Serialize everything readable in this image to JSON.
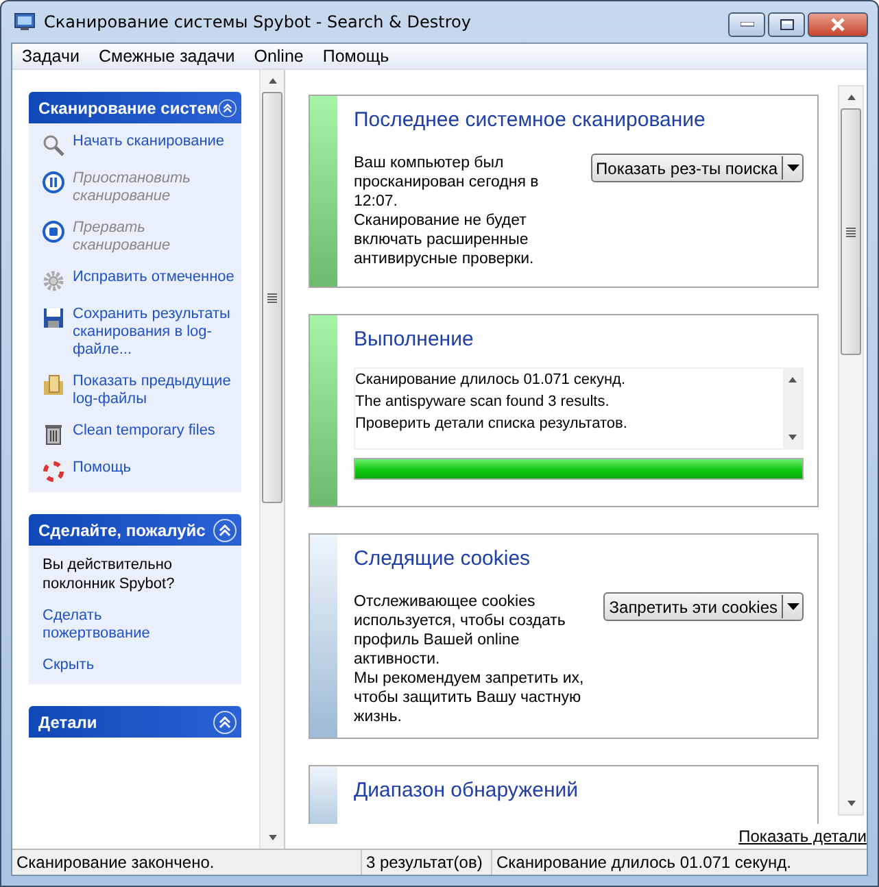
{
  "window": {
    "title": "Сканирование системы  Spybot - Search & Destroy"
  },
  "menu": [
    "Задачи",
    "Смежные задачи",
    "Online",
    "Помощь"
  ],
  "task_panels": [
    {
      "title": "Сканирование систем",
      "expanded": true,
      "items": [
        {
          "kind": "link",
          "label": "Начать сканирование",
          "disabled": false
        },
        {
          "kind": "link",
          "label": "Приостановить сканирование",
          "disabled": true
        },
        {
          "kind": "link",
          "label": "Прервать сканирование",
          "disabled": true
        },
        {
          "kind": "link",
          "label": "Исправить отмеченное",
          "disabled": false
        },
        {
          "kind": "link",
          "label": "Сохранить результаты сканирования в log-файле...",
          "disabled": false
        },
        {
          "kind": "link",
          "label": "Показать предыдущие log-файлы",
          "disabled": false
        },
        {
          "kind": "link",
          "label": "Clean temporary files",
          "disabled": false
        },
        {
          "kind": "link",
          "label": "Помощь",
          "disabled": false
        }
      ]
    },
    {
      "title": "Сделайте, пожалуйс",
      "expanded": true,
      "items": [
        {
          "kind": "text",
          "label": "Вы действительно поклонник Spybot?"
        },
        {
          "kind": "link",
          "label": "Сделать пожертвование"
        },
        {
          "kind": "link",
          "label": "Скрыть"
        }
      ]
    },
    {
      "title": "Детали",
      "expanded": true
    }
  ],
  "cards": [
    {
      "kind": "ok",
      "title": "Последнее системное сканирование",
      "paragraphs": [
        "Ваш компьютер был просканирован сегодня в 12:07.",
        "Сканирование не будет включать расширенные антивирусные проверки."
      ],
      "dropdown": "Показать рез-ты поиска"
    },
    {
      "kind": "ok",
      "title": "Выполнение",
      "log": [
        "Сканирование длилось 01.071 секунд.",
        "The antispyware scan found 3 results.",
        "Проверить детали списка результатов."
      ],
      "progress": {
        "level": 1
      }
    },
    {
      "kind": "info",
      "title": "Следящие cookies",
      "paragraphs": [
        "Отслеживающее cookies используется, чтобы создать профиль Вашей online активности.",
        "Мы рекомендуем запретить их, чтобы защитить Вашу частную жизнь."
      ],
      "dropdown": "Запретить эти cookies"
    },
    {
      "kind": "info",
      "title": "Диапазон обнаружений"
    }
  ],
  "show_details_link": "Показать детали",
  "status_bar": [
    "Сканирование закончено.",
    "3 результат(ов)",
    "Сканирование длилось 01.071 секунд."
  ]
}
